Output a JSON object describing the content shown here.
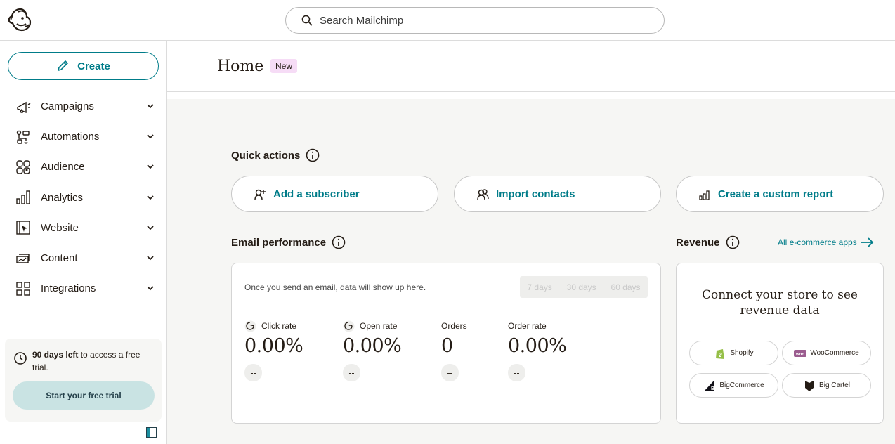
{
  "search": {
    "placeholder": "Search Mailchimp"
  },
  "sidebar": {
    "create_label": "Create",
    "items": [
      {
        "label": "Campaigns",
        "icon": "megaphone-icon"
      },
      {
        "label": "Automations",
        "icon": "automation-flow-icon"
      },
      {
        "label": "Audience",
        "icon": "audience-icon"
      },
      {
        "label": "Analytics",
        "icon": "bar-chart-icon"
      },
      {
        "label": "Website",
        "icon": "website-cursor-icon"
      },
      {
        "label": "Content",
        "icon": "content-stack-icon"
      },
      {
        "label": "Integrations",
        "icon": "grid-icon"
      }
    ],
    "trial": {
      "bold": "90 days left",
      "text": " to access a free trial.",
      "button_label": "Start your free trial"
    }
  },
  "header": {
    "title": "Home",
    "badge": "New"
  },
  "quick_actions": {
    "title": "Quick actions",
    "buttons": [
      {
        "label": "Add a subscriber",
        "icon": "add-person-icon"
      },
      {
        "label": "Import contacts",
        "icon": "contacts-icon"
      },
      {
        "label": "Create a custom report",
        "icon": "report-bars-icon"
      }
    ]
  },
  "email_performance": {
    "title": "Email performance",
    "message": "Once you send an email, data will show up here.",
    "ranges": [
      "7 days",
      "30 days",
      "60 days"
    ],
    "metrics": [
      {
        "label": "Click rate",
        "value": "0.00%",
        "change": "--"
      },
      {
        "label": "Open rate",
        "value": "0.00%",
        "change": "--"
      },
      {
        "label": "Orders",
        "value": "0",
        "change": "--"
      },
      {
        "label": "Order rate",
        "value": "0.00%",
        "change": "--"
      }
    ]
  },
  "revenue": {
    "title": "Revenue",
    "link_label": "All e-commerce apps",
    "connect_title": "Connect your store to see revenue data",
    "stores": [
      "Shopify",
      "WooCommerce",
      "BigCommerce",
      "Big Cartel"
    ]
  },
  "colors": {
    "accent": "#007c89",
    "badge_bg": "#f6dcf6",
    "trial_button": "#c9e3e3",
    "page_bg": "#f6f6f4"
  }
}
